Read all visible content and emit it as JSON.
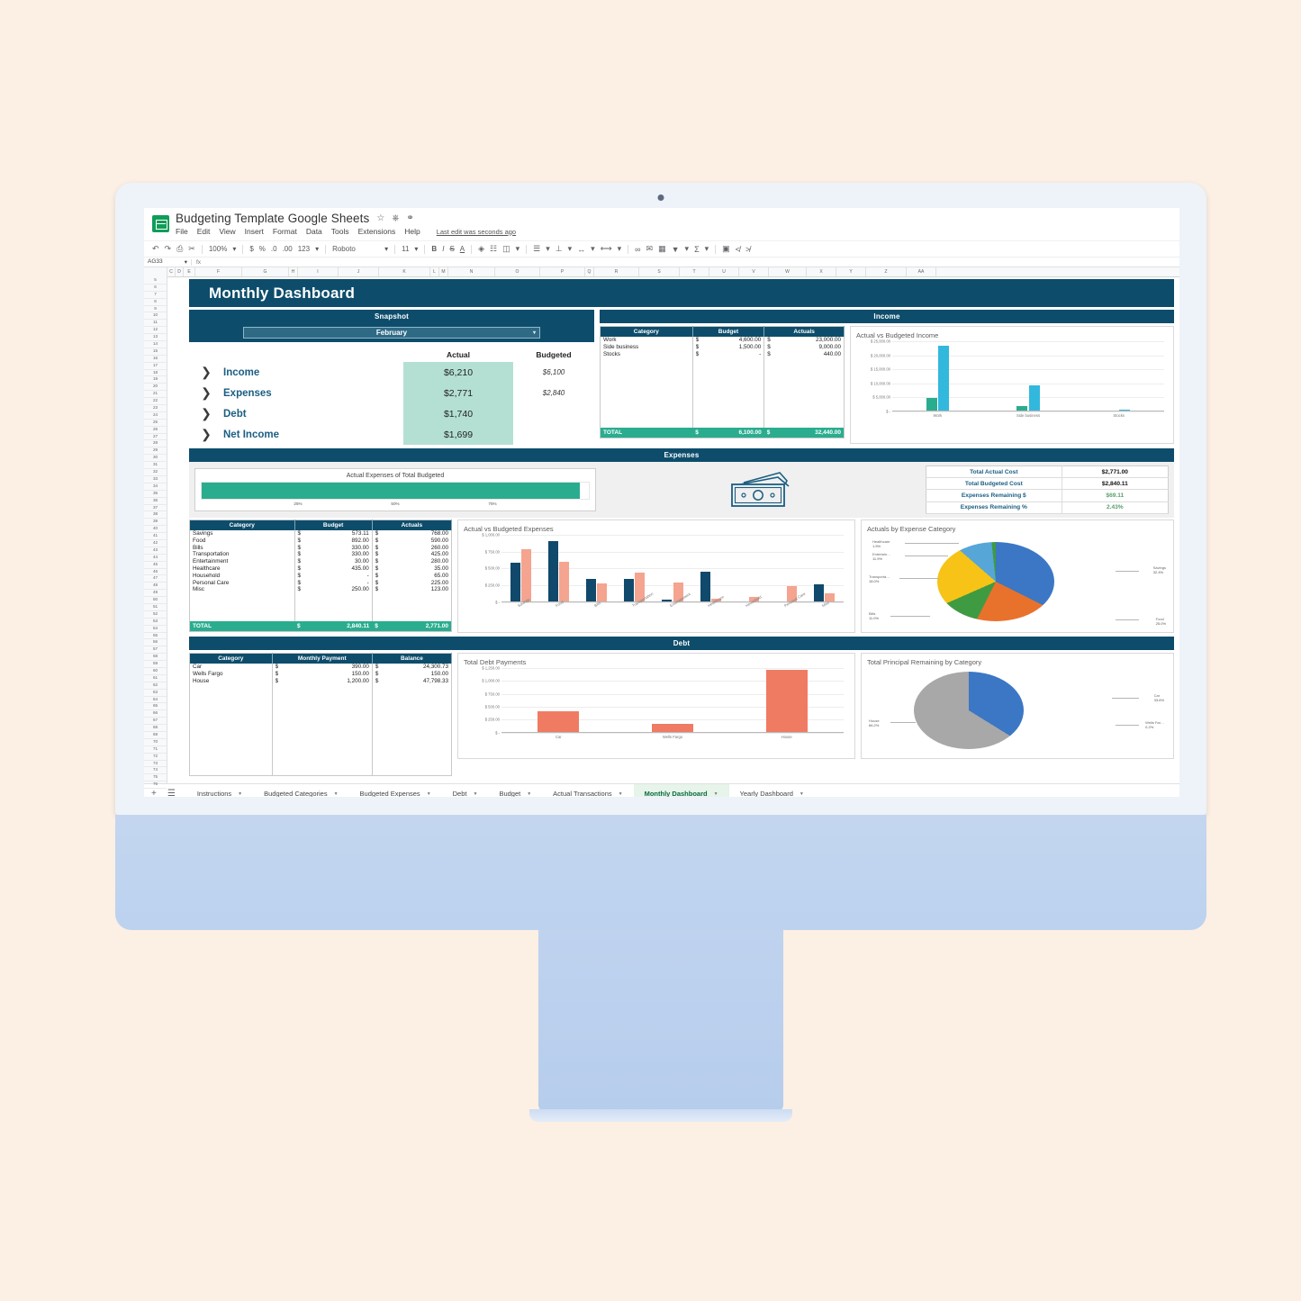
{
  "app": {
    "doc_title": "Budgeting Template Google Sheets",
    "logo_icon": "sheets-logo-icon",
    "title_icons": [
      "star-icon",
      "move-to-folder-icon",
      "cloud-status-icon"
    ],
    "menus": [
      "File",
      "Edit",
      "View",
      "Insert",
      "Format",
      "Data",
      "Tools",
      "Extensions",
      "Help"
    ],
    "last_edit": "Last edit was seconds ago"
  },
  "toolbar": {
    "undo_icon": "undo-icon",
    "redo_icon": "redo-icon",
    "print_icon": "print-icon",
    "paint_icon": "paint-format-icon",
    "zoom": "100%",
    "currency_icon": "$",
    "percent_icon": "%",
    "dec_decrease": ".0",
    "dec_increase": ".00",
    "number_format": "123",
    "font_family": "Roboto",
    "font_size": "11",
    "bold": "B",
    "italic": "I",
    "strikethrough": "S",
    "text_color": "A",
    "fill_icon": "fill-color-icon",
    "borders_icon": "borders-icon",
    "merge_icon": "merge-cells-icon",
    "align_icon": "horizontal-align-icon",
    "valign_icon": "vertical-align-icon",
    "wrap_icon": "text-wrap-icon",
    "rotate_icon": "text-rotation-icon",
    "link_icon": "insert-link-icon",
    "comment_icon": "insert-comment-icon",
    "chart_icon": "insert-chart-icon",
    "filter_icon": "filter-icon",
    "functions_icon": "functions-icon",
    "image_icon": "insert-image-icon",
    "col_icon": "insert-column-icon",
    "row_icon": "insert-row-icon"
  },
  "formula_bar": {
    "name_box": "AG33",
    "fx": "fx",
    "value": ""
  },
  "grid": {
    "columns": [
      "C",
      "D",
      "E",
      "F",
      "G",
      "H",
      "I",
      "J",
      "K",
      "L",
      "M",
      "N",
      "O",
      "P",
      "Q",
      "R",
      "S",
      "T",
      "U",
      "V",
      "W",
      "X",
      "Y",
      "Z",
      "AA"
    ],
    "rows": [
      5,
      6,
      7,
      8,
      9,
      10,
      11,
      12,
      13,
      14,
      15,
      16,
      17,
      18,
      19,
      20,
      21,
      22,
      23,
      24,
      25,
      26,
      27,
      28,
      29,
      30,
      31,
      32,
      33,
      34,
      35,
      36,
      37,
      38,
      39,
      40,
      41,
      42,
      43,
      44,
      45,
      46,
      47,
      48,
      49,
      50,
      51,
      52,
      53,
      54,
      55,
      56,
      57,
      58,
      59,
      60,
      61,
      62,
      63,
      64,
      65,
      66,
      67,
      68,
      69,
      70,
      71,
      72,
      73,
      74,
      75,
      76
    ]
  },
  "dashboard": {
    "banner_title": "Monthly Dashboard",
    "snapshot": {
      "section_title": "Snapshot",
      "month": "February",
      "col_actual": "Actual",
      "col_budgeted": "Budgeted",
      "rows": [
        {
          "label": "Income",
          "actual": "$6,210",
          "budgeted": "$6,100"
        },
        {
          "label": "Expenses",
          "actual": "$2,771",
          "budgeted": "$2,840"
        },
        {
          "label": "Debt",
          "actual": "$1,740",
          "budgeted": ""
        },
        {
          "label": "Net Income",
          "actual": "$1,699",
          "budgeted": ""
        }
      ]
    },
    "income": {
      "section_title": "Income",
      "headers": [
        "Category",
        "Budget",
        "Actuals"
      ],
      "rows": [
        {
          "category": "Work",
          "budget": "4,600.00",
          "actuals": "23,000.00"
        },
        {
          "category": "Side business",
          "budget": "1,500.00",
          "actuals": "9,000.00"
        },
        {
          "category": "Stocks",
          "budget": "-",
          "actuals": "440.00"
        }
      ],
      "total_label": "TOTAL",
      "total_budget": "6,100.00",
      "total_actuals": "32,440.00"
    },
    "expenses": {
      "section_title": "Expenses",
      "progress_title": "Actual Expenses of Total Budgeted",
      "progress_ticks": [
        "25%",
        "50%",
        "75%"
      ],
      "progress_percent": 97.6,
      "money_icon": "money-cash-icon",
      "summary": [
        {
          "key": "Total Actual Cost",
          "value": "$2,771.00",
          "green": false
        },
        {
          "key": "Total Budgeted Cost",
          "value": "$2,840.11",
          "green": false
        },
        {
          "key": "Expenses Remaining $",
          "value": "$69.11",
          "green": true
        },
        {
          "key": "Expenses Remaining %",
          "value": "2.43%",
          "green": true
        }
      ],
      "headers": [
        "Category",
        "Budget",
        "Actuals"
      ],
      "rows": [
        {
          "category": "Savings",
          "budget": "573.11",
          "actuals": "768.00"
        },
        {
          "category": "Food",
          "budget": "892.00",
          "actuals": "590.00"
        },
        {
          "category": "Bills",
          "budget": "330.00",
          "actuals": "260.00"
        },
        {
          "category": "Transportation",
          "budget": "330.00",
          "actuals": "425.00"
        },
        {
          "category": "Entertainment",
          "budget": "30.00",
          "actuals": "280.00"
        },
        {
          "category": "Healthcare",
          "budget": "435.00",
          "actuals": "35.00"
        },
        {
          "category": "Household",
          "budget": "-",
          "actuals": "65.00"
        },
        {
          "category": "Personal Care",
          "budget": "-",
          "actuals": "225.00"
        },
        {
          "category": "Misc",
          "budget": "250.00",
          "actuals": "123.00"
        }
      ],
      "total_label": "TOTAL",
      "total_budget": "2,840.11",
      "total_actuals": "2,771.00"
    },
    "debt": {
      "section_title": "Debt",
      "headers": [
        "Category",
        "Monthly Payment",
        "Balance"
      ],
      "rows": [
        {
          "category": "Car",
          "payment": "390.00",
          "balance": "24,300.73"
        },
        {
          "category": "Wells Fargo",
          "payment": "150.00",
          "balance": "150.00"
        },
        {
          "category": "House",
          "payment": "1,200.00",
          "balance": "47,798.33"
        }
      ]
    }
  },
  "tabs": {
    "add_icon": "add-sheet-icon",
    "list_icon": "all-sheets-icon",
    "items": [
      {
        "label": "Instructions",
        "active": false
      },
      {
        "label": "Budgeted Categories",
        "active": false
      },
      {
        "label": "Budgeted Expenses",
        "active": false
      },
      {
        "label": "Debt",
        "active": false
      },
      {
        "label": "Budget",
        "active": false
      },
      {
        "label": "Actual Transactions",
        "active": false
      },
      {
        "label": "Monthly Dashboard",
        "active": true
      },
      {
        "label": "Yearly Dashboard",
        "active": false
      }
    ]
  },
  "colors": {
    "header_navy": "#0d4d6b",
    "teal": "#2aad8f",
    "mint": "#b4e0d4",
    "income_budget_bar": "#2aad8f",
    "income_actual_bar": "#32b8dd",
    "expense_budget_bar": "#10496b",
    "expense_actual_bar": "#f4a48f",
    "debt_bar": "#ef7b63",
    "page_bg": "#fcefe3"
  },
  "chart_data": [
    {
      "type": "bar",
      "title": "Actual vs Budgeted Income",
      "categories": [
        "Work",
        "Side business",
        "Stocks"
      ],
      "series": [
        {
          "name": "Budget",
          "values": [
            4600,
            1500,
            0
          ],
          "color": "#2aad8f"
        },
        {
          "name": "Actuals",
          "values": [
            23000,
            9000,
            440
          ],
          "color": "#32b8dd"
        }
      ],
      "ytick_labels": [
        "$ -",
        "$ 5,000.00",
        "$ 10,000.00",
        "$ 15,000.00",
        "$ 20,000.00",
        "$ 25,000.00"
      ],
      "ylim": [
        0,
        25000
      ],
      "xlabel": "",
      "ylabel": "",
      "grid": true,
      "legend": "none"
    },
    {
      "type": "bar",
      "title": "Actual vs Budgeted Expenses",
      "categories": [
        "Savings",
        "Food",
        "Bills",
        "Transportation",
        "Entertainment",
        "Healthcare",
        "Household",
        "Personal Care",
        "Misc"
      ],
      "series": [
        {
          "name": "Budget",
          "values": [
            573.11,
            892,
            330,
            330,
            30,
            435,
            0,
            0,
            250
          ],
          "color": "#10496b"
        },
        {
          "name": "Actuals",
          "values": [
            768,
            590,
            260,
            425,
            280,
            35,
            65,
            225,
            123
          ],
          "color": "#f4a48f"
        }
      ],
      "ytick_labels": [
        "$ -",
        "$ 250.00",
        "$ 500.00",
        "$ 750.00",
        "$ 1,000.00"
      ],
      "ylim": [
        0,
        1000
      ],
      "xlabel": "",
      "ylabel": "",
      "grid": true,
      "legend": "none"
    },
    {
      "type": "pie",
      "title": "Actuals by Expense Category",
      "slices": [
        {
          "label": "Savings",
          "percent": 32.4,
          "color": "#3b77c4"
        },
        {
          "label": "Food",
          "percent": 25.0,
          "color": "#e8722c"
        },
        {
          "label": "Bills",
          "percent": 11.0,
          "color": "#3f9b42"
        },
        {
          "label": "Transporta…",
          "percent": 18.0,
          "color": "#f6c316"
        },
        {
          "label": "Entertain…",
          "percent": 11.9,
          "color": "#56a6d8"
        },
        {
          "label": "Healthcare",
          "percent": 1.5,
          "color": "#3f9b42"
        }
      ]
    },
    {
      "type": "bar",
      "title": "Total Debt Payments",
      "categories": [
        "Car",
        "Wells Fargo",
        "House"
      ],
      "series": [
        {
          "name": "Monthly Payment",
          "values": [
            390,
            150,
            1200
          ],
          "color": "#ef7b63"
        }
      ],
      "ytick_labels": [
        "$ -",
        "$ 250.00",
        "$ 500.00",
        "$ 750.00",
        "$ 1,000.00",
        "$ 1,250.00"
      ],
      "ylim": [
        0,
        1250
      ],
      "xlabel": "",
      "ylabel": "",
      "grid": true,
      "legend": "none"
    },
    {
      "type": "pie",
      "title": "Total Principal Remaining by Category",
      "slices": [
        {
          "label": "Car",
          "percent": 33.6,
          "color": "#3b77c4"
        },
        {
          "label": "Wells Far…",
          "percent": 0.2,
          "color": "#3b77c4"
        },
        {
          "label": "House",
          "percent": 66.2,
          "color": "#a8a8a8"
        }
      ]
    }
  ]
}
